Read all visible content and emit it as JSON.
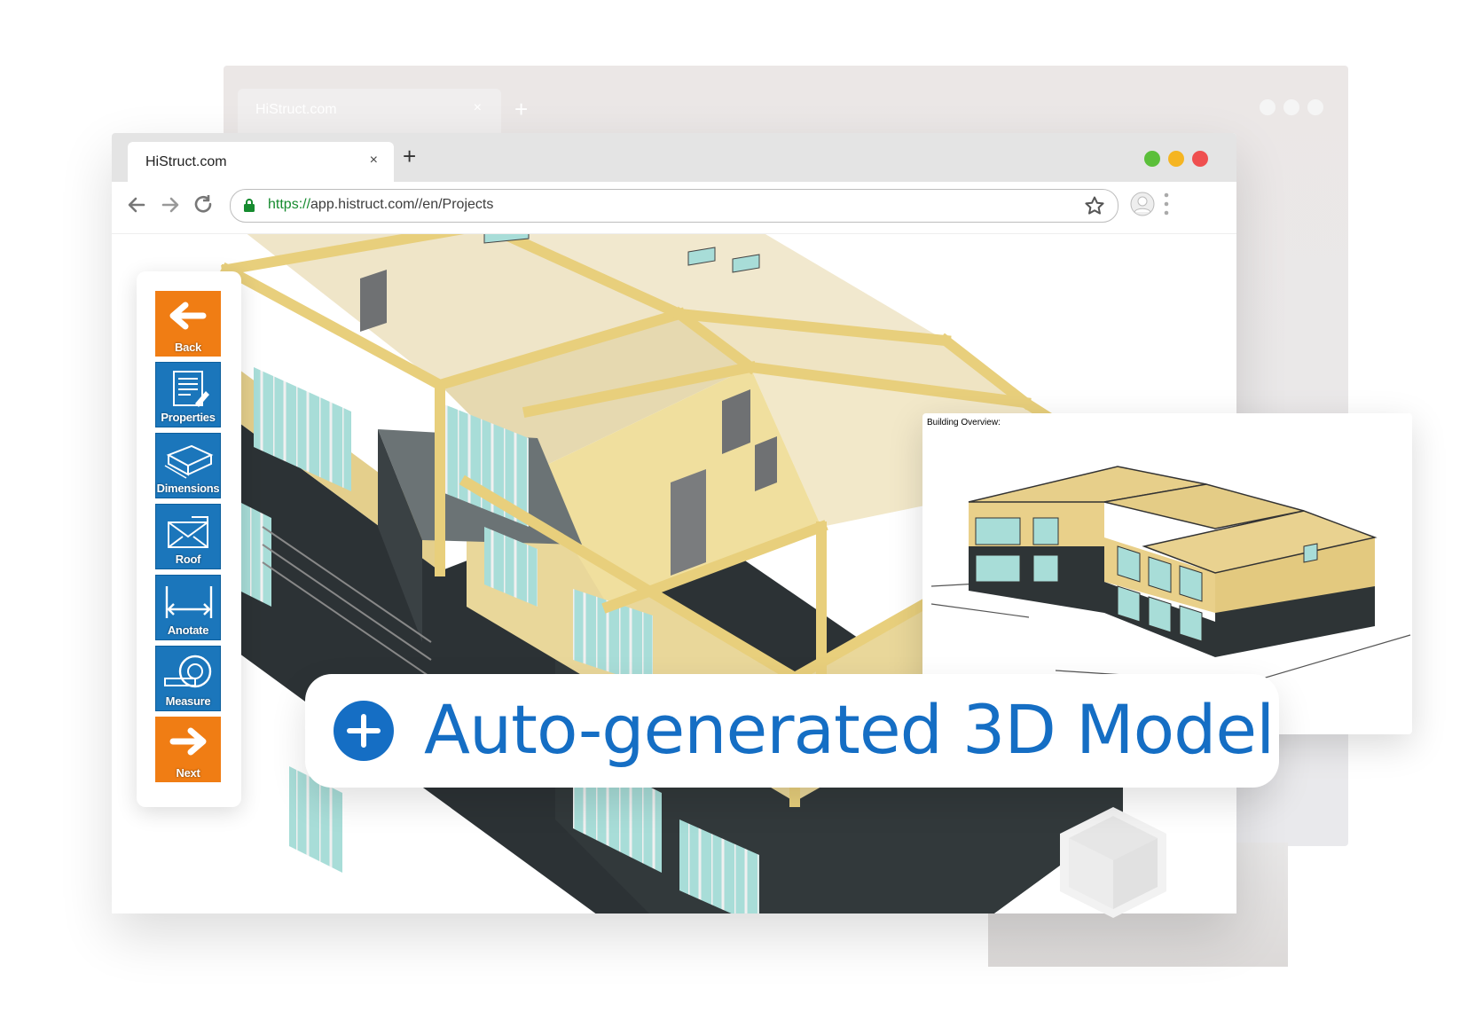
{
  "back_browser": {
    "tab_title": "HiStruct.com",
    "tab_close": "×",
    "new_tab": "+"
  },
  "front_browser": {
    "tab_title": "HiStruct.com",
    "tab_close": "×",
    "new_tab": "+",
    "window_controls": [
      {
        "name": "maximize",
        "color": "#5bbf3a"
      },
      {
        "name": "minimize",
        "color": "#f5b522"
      },
      {
        "name": "close",
        "color": "#ef4f4f"
      }
    ],
    "url_scheme": "https://",
    "url_rest": "app.histruct.com//en/Projects"
  },
  "toolbar": {
    "items": [
      {
        "label": "Back",
        "icon": "arrow-left-icon",
        "color": "#f07d14"
      },
      {
        "label": "Properties",
        "icon": "properties-icon",
        "color": "#1b76bb"
      },
      {
        "label": "Dimensions",
        "icon": "dimensions-icon",
        "color": "#1b76bb"
      },
      {
        "label": "Roof",
        "icon": "roof-icon",
        "color": "#1b76bb"
      },
      {
        "label": "Anotate",
        "icon": "annotate-icon",
        "color": "#1b76bb"
      },
      {
        "label": "Measure",
        "icon": "measure-tape-icon",
        "color": "#1b76bb"
      },
      {
        "label": "Next",
        "icon": "arrow-right-icon",
        "color": "#f07d14"
      }
    ]
  },
  "overview": {
    "title": "Building Overview:"
  },
  "banner": {
    "text": "Auto-generated 3D Model",
    "accent": "#156ec4"
  }
}
